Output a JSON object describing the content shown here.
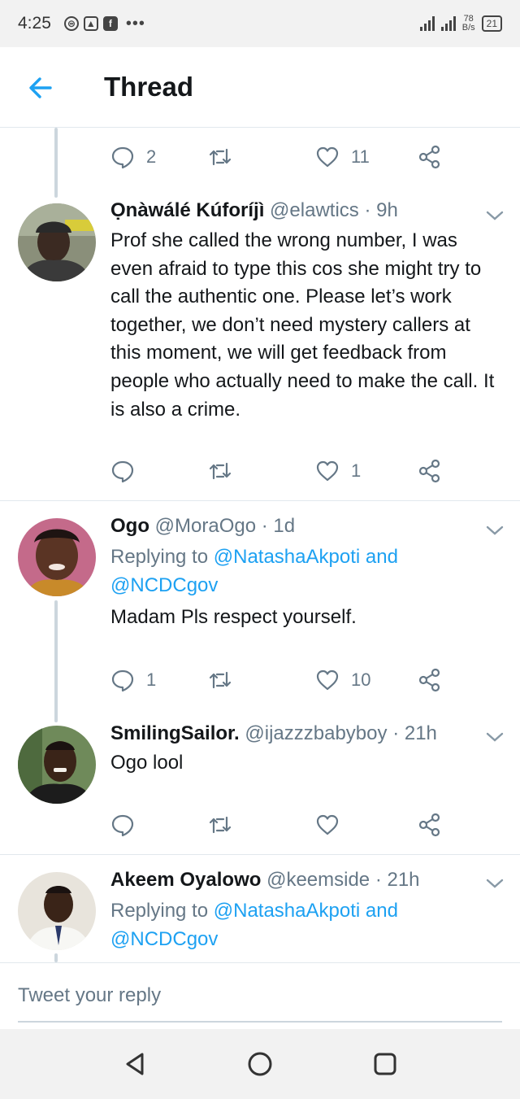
{
  "status_bar": {
    "time": "4:25",
    "net_speed_value": "78",
    "net_speed_unit": "B/s",
    "battery": "21"
  },
  "header": {
    "title": "Thread"
  },
  "top_actions": {
    "reply_count": "2",
    "retweet_count": "",
    "like_count": "11"
  },
  "tweets": [
    {
      "name": "Ọnàwálé Kúforíjì",
      "handle": "@elawtics",
      "time": "· 9h",
      "text": "Prof she called the wrong number, I was even afraid to type this cos she might try to call the authentic one. Please let’s work together, we don’t need mystery callers at this moment, we will get feedback from people who actually need to make the call. It is also a crime.",
      "reply_count": "",
      "retweet_count": "",
      "like_count": "1"
    },
    {
      "name": "Ogo",
      "handle": "@MoraOgo",
      "time": "· 1d",
      "replying_prefix": "Replying to",
      "replying_user1": "@NatashaAkpoti",
      "replying_and": "and",
      "replying_user2": "@NCDCgov",
      "text": "Madam Pls respect yourself.",
      "reply_count": "1",
      "retweet_count": "",
      "like_count": "10"
    },
    {
      "name": "SmilingSailor.",
      "handle": "@ijazzzbabyboy",
      "time": "· 21h",
      "text": "Ogo lool",
      "reply_count": "",
      "retweet_count": "",
      "like_count": ""
    },
    {
      "name": "Akeem Oyalowo",
      "handle": "@keemside",
      "time": "· 21h",
      "replying_prefix": "Replying to",
      "replying_user1": "@NatashaAkpoti",
      "replying_and": "and",
      "replying_user2": "@NCDCgov"
    }
  ],
  "reply_box": {
    "placeholder": "Tweet your reply"
  },
  "colors": {
    "accent": "#1da1f2",
    "muted": "#657786",
    "divider": "#e1e8ed"
  }
}
